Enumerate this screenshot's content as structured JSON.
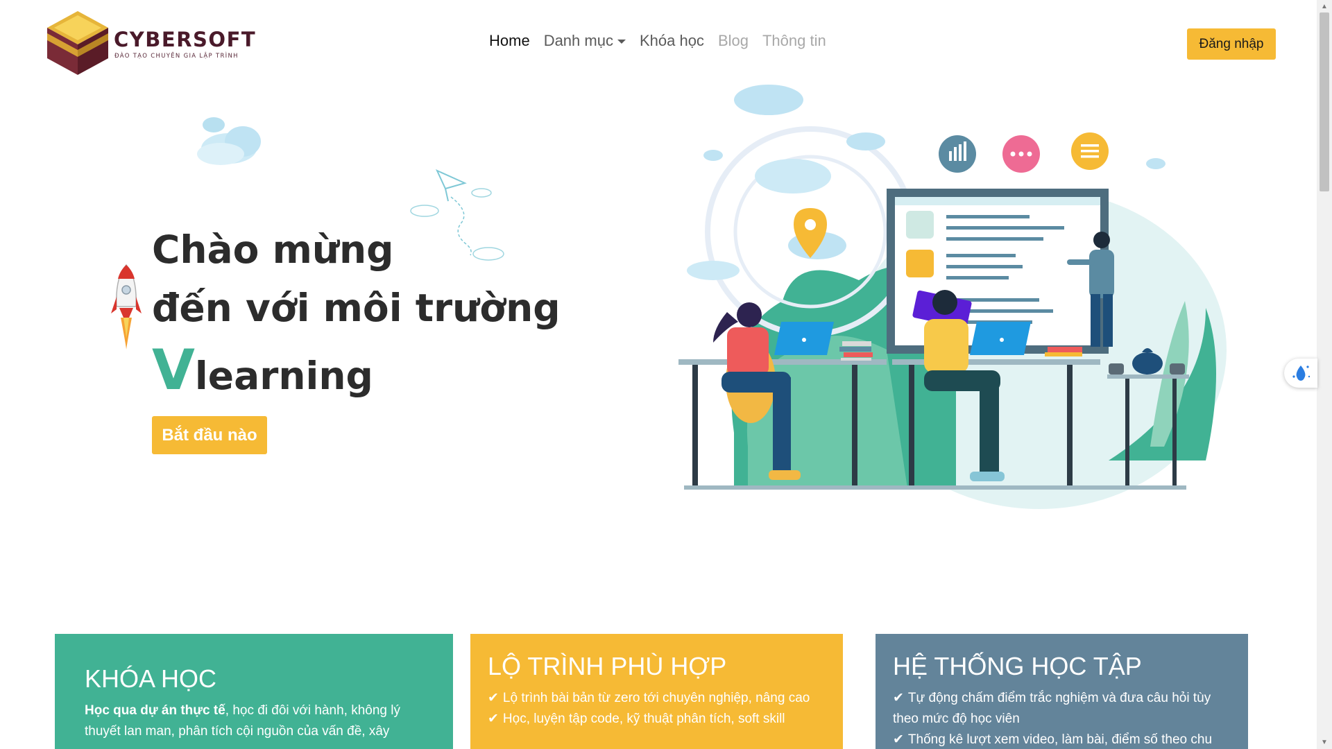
{
  "brand": {
    "name": "CYBERSOFT",
    "tagline": "ĐÀO TẠO CHUYÊN GIA LẬP TRÌNH"
  },
  "nav": {
    "items": [
      {
        "label": "Home",
        "state": "active"
      },
      {
        "label": "Danh mục",
        "state": "dropdown"
      },
      {
        "label": "Khóa học",
        "state": "normal"
      },
      {
        "label": "Blog",
        "state": "muted"
      },
      {
        "label": "Thông tin",
        "state": "muted"
      }
    ],
    "login_label": "Đăng nhập"
  },
  "hero": {
    "line1": "Chào mừng",
    "line2": "đến với môi trường",
    "brand_initial": "V",
    "brand_rest": "learning",
    "cta_label": "Bắt đầu nào"
  },
  "cards": {
    "courses": {
      "title": "KHÓA HỌC",
      "lead_bold": "Học qua dự án thực tế",
      "lead_text": ", học đi đôi với hành, không lý thuyết lan man, phân tích cội nguồn của vấn đề, xây"
    },
    "roadmap": {
      "title": "LỘ TRÌNH PHÙ HỢP",
      "items": [
        "Lộ trình bài bản từ zero tới chuyên nghiệp, nâng cao",
        "Học, luyện tập code, kỹ thuật phân tích, soft skill"
      ]
    },
    "system": {
      "title": "HỆ THỐNG HỌC TẬP",
      "items": [
        "Tự động chấm điểm trắc nghiệm và đưa câu hỏi tùy theo mức độ học viên",
        "Thống kê lượt xem video, làm bài, điểm số theo chu"
      ]
    }
  },
  "colors": {
    "accent_yellow": "#f6ba35",
    "accent_green": "#41b294",
    "accent_slate": "#63849a",
    "brand_maroon": "#4a1a2a",
    "text_dark": "#2c2c2c"
  },
  "icons": [
    "logo-cube",
    "rocket-icon",
    "paper-plane-icon",
    "cloud-icon",
    "bar-chart-icon",
    "chat-dots-icon",
    "list-icon",
    "checkmark-icon",
    "scroll-up-icon",
    "scroll-down-icon",
    "accessibility-widget-icon"
  ]
}
